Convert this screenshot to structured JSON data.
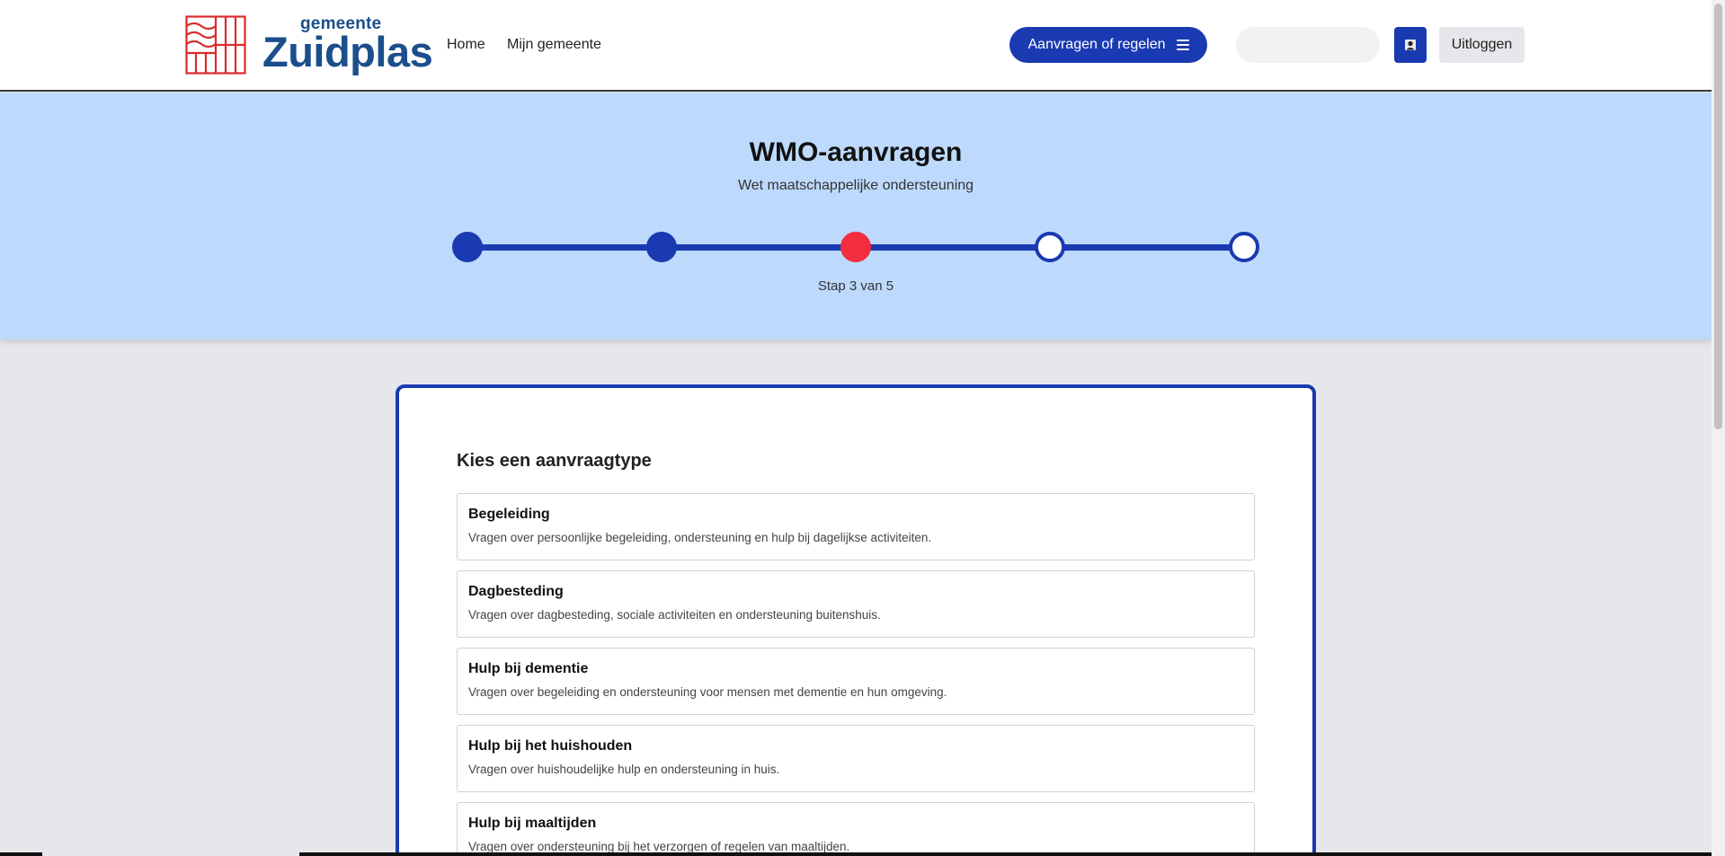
{
  "header": {
    "logo_small": "gemeente",
    "logo_big": "Zuidplas",
    "nav": [
      {
        "label": "Home"
      },
      {
        "label": "Mijn gemeente"
      }
    ],
    "primary_button": "Aanvragen of regelen",
    "search_placeholder": "",
    "logout": "Uitloggen",
    "accent_color": "#1a3ab2",
    "logo_color": "#d92b2b"
  },
  "hero": {
    "title": "WMO-aanvragen",
    "subtitle": "Wet maatschappelijke ondersteuning",
    "current_step": 3,
    "total_steps": 5,
    "step_label": "Stap 3 van 5",
    "completed_color": "#1a3ab2",
    "current_color": "#f22e3f"
  },
  "card": {
    "heading": "Kies een aanvraagtype",
    "options": [
      {
        "title": "Begeleiding",
        "description": "Vragen over persoonlijke begeleiding, ondersteuning en hulp bij dagelijkse activiteiten."
      },
      {
        "title": "Dagbesteding",
        "description": "Vragen over dagbesteding, sociale activiteiten en ondersteuning buitenshuis."
      },
      {
        "title": "Hulp bij dementie",
        "description": "Vragen over begeleiding en ondersteuning voor mensen met dementie en hun omgeving."
      },
      {
        "title": "Hulp bij het huishouden",
        "description": "Vragen over huishoudelijke hulp en ondersteuning in huis."
      },
      {
        "title": "Hulp bij maaltijden",
        "description": "Vragen over ondersteuning bij het verzorgen of regelen van maaltijden."
      }
    ]
  }
}
